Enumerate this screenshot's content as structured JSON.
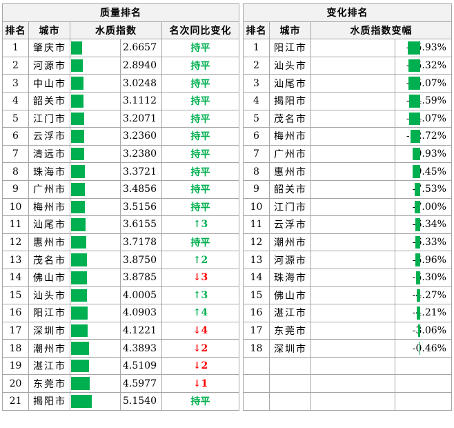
{
  "quality": {
    "title": "质量排名",
    "headers": {
      "rank": "排名",
      "city": "城市",
      "index": "水质指数",
      "change": "名次同比变化"
    },
    "rows": [
      {
        "rank": "1",
        "city": "肇庆市",
        "index": 2.6657,
        "index_text": "2.6657",
        "change": "持平",
        "trend": "flat"
      },
      {
        "rank": "2",
        "city": "河源市",
        "index": 2.894,
        "index_text": "2.8940",
        "change": "持平",
        "trend": "flat"
      },
      {
        "rank": "3",
        "city": "中山市",
        "index": 3.0248,
        "index_text": "3.0248",
        "change": "持平",
        "trend": "flat"
      },
      {
        "rank": "4",
        "city": "韶关市",
        "index": 3.1112,
        "index_text": "3.1112",
        "change": "持平",
        "trend": "flat"
      },
      {
        "rank": "5",
        "city": "江门市",
        "index": 3.2071,
        "index_text": "3.2071",
        "change": "持平",
        "trend": "flat"
      },
      {
        "rank": "6",
        "city": "云浮市",
        "index": 3.236,
        "index_text": "3.2360",
        "change": "持平",
        "trend": "flat"
      },
      {
        "rank": "7",
        "city": "清远市",
        "index": 3.238,
        "index_text": "3.2380",
        "change": "持平",
        "trend": "flat"
      },
      {
        "rank": "8",
        "city": "珠海市",
        "index": 3.3721,
        "index_text": "3.3721",
        "change": "持平",
        "trend": "flat"
      },
      {
        "rank": "9",
        "city": "广州市",
        "index": 3.4856,
        "index_text": "3.4856",
        "change": "持平",
        "trend": "flat"
      },
      {
        "rank": "10",
        "city": "梅州市",
        "index": 3.5156,
        "index_text": "3.5156",
        "change": "持平",
        "trend": "flat"
      },
      {
        "rank": "11",
        "city": "汕尾市",
        "index": 3.6155,
        "index_text": "3.6155",
        "change": "↑3",
        "trend": "up"
      },
      {
        "rank": "12",
        "city": "惠州市",
        "index": 3.7178,
        "index_text": "3.7178",
        "change": "持平",
        "trend": "flat"
      },
      {
        "rank": "13",
        "city": "茂名市",
        "index": 3.875,
        "index_text": "3.8750",
        "change": "↑2",
        "trend": "up"
      },
      {
        "rank": "14",
        "city": "佛山市",
        "index": 3.8785,
        "index_text": "3.8785",
        "change": "↓3",
        "trend": "down"
      },
      {
        "rank": "15",
        "city": "汕头市",
        "index": 4.0005,
        "index_text": "4.0005",
        "change": "↑3",
        "trend": "up"
      },
      {
        "rank": "16",
        "city": "阳江市",
        "index": 4.0903,
        "index_text": "4.0903",
        "change": "↑4",
        "trend": "up"
      },
      {
        "rank": "17",
        "city": "深圳市",
        "index": 4.1221,
        "index_text": "4.1221",
        "change": "↓4",
        "trend": "down"
      },
      {
        "rank": "18",
        "city": "潮州市",
        "index": 4.3893,
        "index_text": "4.3893",
        "change": "↓2",
        "trend": "down"
      },
      {
        "rank": "19",
        "city": "湛江市",
        "index": 4.5109,
        "index_text": "4.5109",
        "change": "↓2",
        "trend": "down"
      },
      {
        "rank": "20",
        "city": "东莞市",
        "index": 4.5977,
        "index_text": "4.5977",
        "change": "↓1",
        "trend": "down"
      },
      {
        "rank": "21",
        "city": "揭阳市",
        "index": 5.154,
        "index_text": "5.1540",
        "change": "持平",
        "trend": "flat"
      }
    ]
  },
  "variation": {
    "title": "变化排名",
    "headers": {
      "rank": "排名",
      "city": "城市",
      "change": "水质指数变幅"
    },
    "rows": [
      {
        "rank": "1",
        "city": "阳江市",
        "pct": -15.93,
        "pct_text": "-15.93%"
      },
      {
        "rank": "2",
        "city": "汕头市",
        "pct": -15.32,
        "pct_text": "-15.32%"
      },
      {
        "rank": "3",
        "city": "汕尾市",
        "pct": -15.07,
        "pct_text": "-15.07%"
      },
      {
        "rank": "4",
        "city": "揭阳市",
        "pct": -14.59,
        "pct_text": "-14.59%"
      },
      {
        "rank": "5",
        "city": "茂名市",
        "pct": -14.07,
        "pct_text": "-14.07%"
      },
      {
        "rank": "6",
        "city": "梅州市",
        "pct": -12.72,
        "pct_text": "-12.72%"
      },
      {
        "rank": "7",
        "city": "广州市",
        "pct": -9.93,
        "pct_text": "-9.93%"
      },
      {
        "rank": "8",
        "city": "惠州市",
        "pct": -9.45,
        "pct_text": "-9.45%"
      },
      {
        "rank": "9",
        "city": "韶关市",
        "pct": -7.53,
        "pct_text": "-7.53%"
      },
      {
        "rank": "10",
        "city": "江门市",
        "pct": -7.0,
        "pct_text": "-7.00%"
      },
      {
        "rank": "11",
        "city": "云浮市",
        "pct": -6.34,
        "pct_text": "-6.34%"
      },
      {
        "rank": "12",
        "city": "潮州市",
        "pct": -6.33,
        "pct_text": "-6.33%"
      },
      {
        "rank": "13",
        "city": "河源市",
        "pct": -5.96,
        "pct_text": "-5.96%"
      },
      {
        "rank": "14",
        "city": "珠海市",
        "pct": -5.3,
        "pct_text": "-5.30%"
      },
      {
        "rank": "15",
        "city": "佛山市",
        "pct": -4.27,
        "pct_text": "-4.27%"
      },
      {
        "rank": "16",
        "city": "湛江市",
        "pct": -4.21,
        "pct_text": "-4.21%"
      },
      {
        "rank": "17",
        "city": "东莞市",
        "pct": -3.06,
        "pct_text": "-3.06%"
      },
      {
        "rank": "18",
        "city": "深圳市",
        "pct": -0.46,
        "pct_text": "-0.46%"
      }
    ]
  },
  "colors": {
    "bar": "#00b050",
    "flat": "#00b050",
    "up": "#00b050",
    "down": "#ff0000",
    "header_bg": "#f2f2f2",
    "grid": "#a6a6a6"
  },
  "chart_data": [
    {
      "type": "table",
      "title": "质量排名",
      "columns": [
        "排名",
        "城市",
        "水质指数",
        "名次同比变化"
      ],
      "categories": [
        "肇庆市",
        "河源市",
        "中山市",
        "韶关市",
        "江门市",
        "云浮市",
        "清远市",
        "珠海市",
        "广州市",
        "梅州市",
        "汕尾市",
        "惠州市",
        "茂名市",
        "佛山市",
        "汕头市",
        "阳江市",
        "深圳市",
        "潮州市",
        "湛江市",
        "东莞市",
        "揭阳市"
      ],
      "values": [
        2.6657,
        2.894,
        3.0248,
        3.1112,
        3.2071,
        3.236,
        3.238,
        3.3721,
        3.4856,
        3.5156,
        3.6155,
        3.7178,
        3.875,
        3.8785,
        4.0005,
        4.0903,
        4.1221,
        4.3893,
        4.5109,
        4.5977,
        5.154
      ]
    },
    {
      "type": "table",
      "title": "变化排名",
      "columns": [
        "排名",
        "城市",
        "水质指数变幅"
      ],
      "categories": [
        "阳江市",
        "汕头市",
        "汕尾市",
        "揭阳市",
        "茂名市",
        "梅州市",
        "广州市",
        "惠州市",
        "韶关市",
        "江门市",
        "云浮市",
        "潮州市",
        "河源市",
        "珠海市",
        "佛山市",
        "湛江市",
        "东莞市",
        "深圳市"
      ],
      "values": [
        -15.93,
        -15.32,
        -15.07,
        -14.59,
        -14.07,
        -12.72,
        -9.93,
        -9.45,
        -7.53,
        -7.0,
        -6.34,
        -6.33,
        -5.96,
        -5.3,
        -4.27,
        -4.21,
        -3.06,
        -0.46
      ]
    }
  ]
}
